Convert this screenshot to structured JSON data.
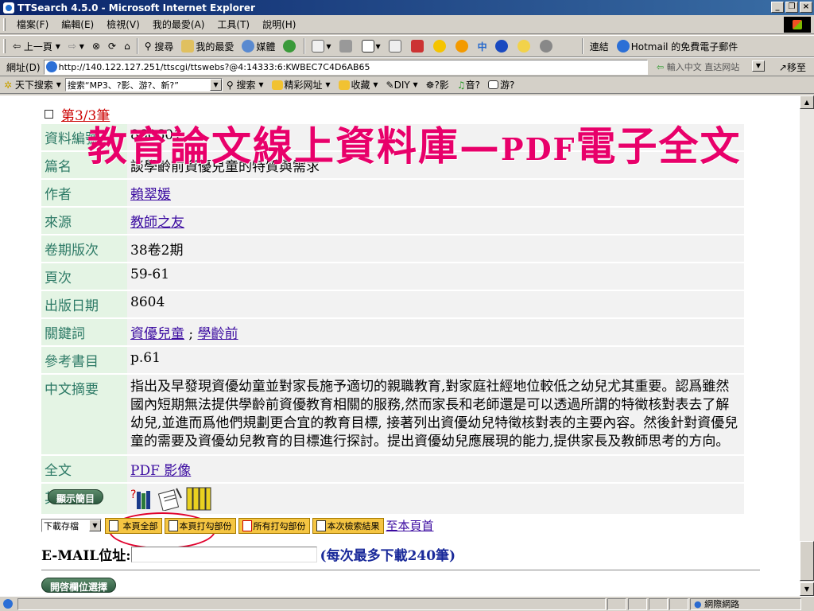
{
  "window": {
    "title": "TTSearch 4.5.0 - Microsoft Internet Explorer"
  },
  "menu": [
    "檔案(F)",
    "編輯(E)",
    "檢視(V)",
    "我的最愛(A)",
    "工具(T)",
    "說明(H)"
  ],
  "toolbar": {
    "back": "上一頁",
    "search": "搜尋",
    "favorites": "我的最愛",
    "media": "媒體",
    "links": "連結",
    "hotmail": "Hotmail 的免費電子郵件"
  },
  "address": {
    "label": "網址(D)",
    "url": "http://140.122.127.251/ttscgi/ttswebs?@4:14333:6:KWBEC7C4D6AB65",
    "hint": "輸入中文 直达网站",
    "go": "移至"
  },
  "toolbar2": {
    "sky": "天下搜索",
    "query": "搜索“MP3、?影、游?、新?”",
    "search": "搜索",
    "sites": "精彩网址",
    "collect": "收藏",
    "diy": "DIY",
    "movie": "?影",
    "music": "音?",
    "game": "游?"
  },
  "banner": {
    "title": "教育論文線上資料庫—",
    "pdf": "PDF",
    "suffix": "電子全文"
  },
  "record": {
    "count": "第3/3筆",
    "fields": [
      {
        "label": "資料編號",
        "value": "860601"
      },
      {
        "label": "篇名",
        "value": "談學齡前資優兒童的特質與需求"
      },
      {
        "label": "作者",
        "value": "賴翠媛"
      },
      {
        "label": "來源",
        "value": "教師之友"
      },
      {
        "label": "卷期版次",
        "value": "38卷2期"
      },
      {
        "label": "頁次",
        "value": "59-61"
      },
      {
        "label": "出版日期",
        "value": "8604"
      },
      {
        "label": "關鍵詞",
        "value": "資優兒童",
        "value2": "學齡前"
      },
      {
        "label": "參考書目",
        "value": "p.61"
      },
      {
        "label": "中文摘要",
        "value": "指出及早發現資優幼童並對家長施予適切的親職教育,對家庭社經地位較低之幼兒尤其重要。認爲雖然國內短期無法提供學齡前資優教育相關的服務,然而家長和老師還是可以透過所謂的特徵核對表去了解幼兒,並進而爲他們規劃更合宜的教育目標, 接著列出資優幼兒特徵核對表的主要內容。然後針對資優兒童的需要及資優幼兒教育的目標進行探討。提出資優幼兒應展現的能力,提供家長及教師思考的方向。"
      },
      {
        "label": "全文",
        "value": "PDF 影像"
      },
      {
        "label": "其他連結",
        "value": ""
      }
    ]
  },
  "actions": {
    "show_brief": "顯示簡目",
    "download_select": "下載存檔",
    "page_all": "本頁全部",
    "page_checked": "本頁打勾部份",
    "all_checked": "所有打勾部份",
    "session_results": "本次檢索結果",
    "to_top": "至本頁首",
    "email_label": "E-MAIL位址:",
    "email_note": "(每次最多下載240筆)",
    "open_fields": "開啓欄位選擇"
  },
  "status": {
    "zone": "網際網路"
  }
}
